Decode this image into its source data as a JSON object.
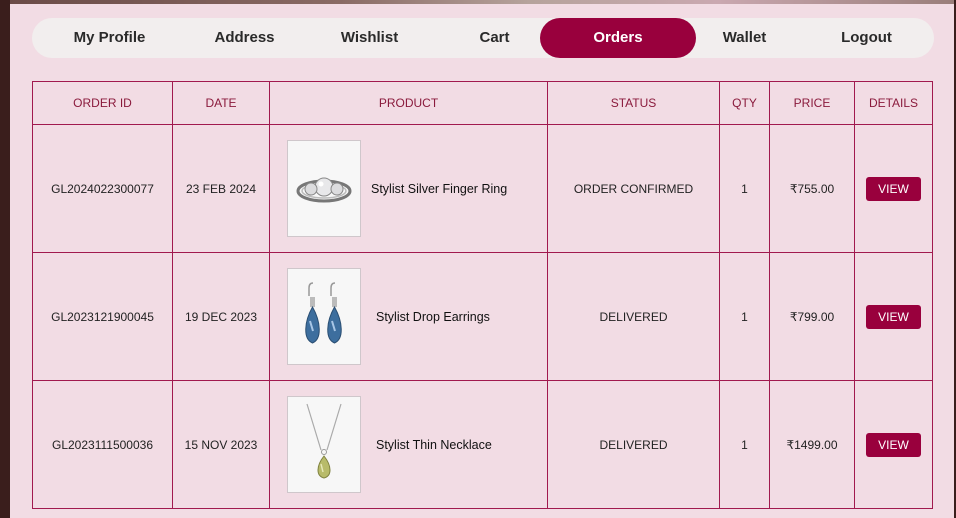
{
  "nav": {
    "tabs": [
      {
        "label": "My Profile"
      },
      {
        "label": "Address"
      },
      {
        "label": "Wishlist"
      },
      {
        "label": "Cart"
      },
      {
        "label": "Orders"
      },
      {
        "label": "Wallet"
      },
      {
        "label": "Logout"
      }
    ],
    "active_tab": "Orders"
  },
  "orders_table": {
    "headers": [
      "ORDER ID",
      "DATE",
      "PRODUCT",
      "STATUS",
      "QTY",
      "PRICE",
      "DETAILS"
    ],
    "rows": [
      {
        "order_id": "GL2024022300077",
        "date": "23 FEB 2024",
        "product": "Stylist Silver Finger Ring",
        "product_icon": "ring-image",
        "status": "ORDER CONFIRMED",
        "qty": "1",
        "price": "₹755.00",
        "details": "VIEW"
      },
      {
        "order_id": "GL2023121900045",
        "date": "19 DEC 2023",
        "product": "Stylist Drop Earrings",
        "product_icon": "earrings-image",
        "status": "DELIVERED",
        "qty": "1",
        "price": "₹799.00",
        "details": "VIEW"
      },
      {
        "order_id": "GL2023111500036",
        "date": "15 NOV 2023",
        "product": "Stylist Thin Necklace",
        "product_icon": "necklace-image",
        "status": "DELIVERED",
        "qty": "1",
        "price": "₹1499.00",
        "details": "VIEW"
      }
    ]
  },
  "colors": {
    "accent": "#99003d",
    "panel": "#f2dce4",
    "border": "#a1194e"
  }
}
